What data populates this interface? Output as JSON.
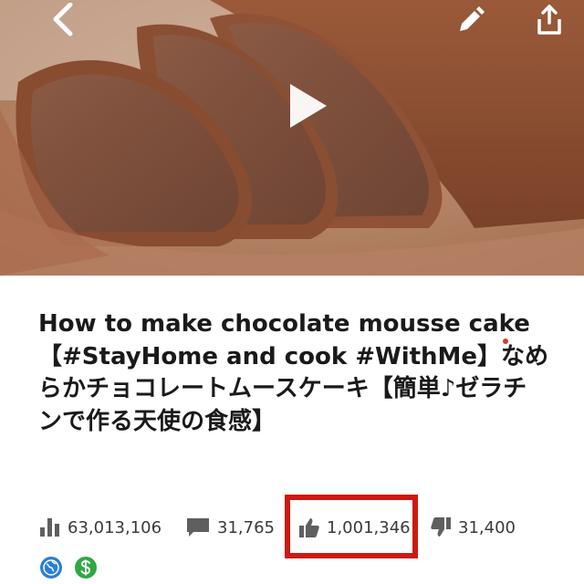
{
  "video": {
    "title": "How to make chocolate mousse cake【#StayHome and cook #WithMe】なめらかチョコレートムースケーキ【簡単♪ゼラチンで作る天使の食感】"
  },
  "stats": {
    "views": "63,013,106",
    "comments": "31,765",
    "likes": "1,001,346",
    "dislikes": "31,400"
  },
  "icons": {
    "back": "chevron-left-icon",
    "edit": "pencil-icon",
    "share": "share-icon",
    "play": "play-icon",
    "views": "bar-chart-icon",
    "comments": "comment-icon",
    "likes": "thumbs-up-icon",
    "dislikes": "thumbs-down-icon",
    "globe": "globe-icon",
    "monetization": "dollar-icon"
  },
  "colors": {
    "highlight": "#cc1a12",
    "icon_gray": "#5f5f5f",
    "globe_blue": "#2a7fd6",
    "money_green": "#2fa844"
  }
}
